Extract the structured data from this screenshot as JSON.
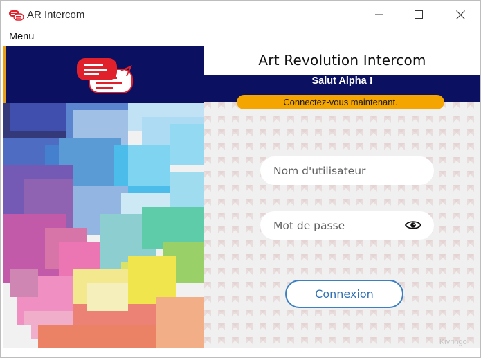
{
  "window": {
    "title": "AR Intercom",
    "controls": {
      "minimize": "minimize",
      "maximize": "maximize",
      "close": "close"
    }
  },
  "menu": {
    "label": "Menu"
  },
  "header": {
    "app_title": "Art Revolution Intercom",
    "greeting": "Salut Alpha !",
    "notice": "Connectez-vous maintenant."
  },
  "login": {
    "username_placeholder": "Nom d'utilisateur",
    "password_placeholder": "Mot de passe",
    "submit_label": "Connexion"
  },
  "footer": {
    "watermark": "Kivringo"
  },
  "colors": {
    "navy": "#0b1160",
    "accent_orange": "#f5a500",
    "button_blue": "#3a80c3",
    "logo_red": "#e0202b"
  },
  "icons": {
    "app": "chat-bubbles-icon",
    "show_password": "eye-icon"
  }
}
